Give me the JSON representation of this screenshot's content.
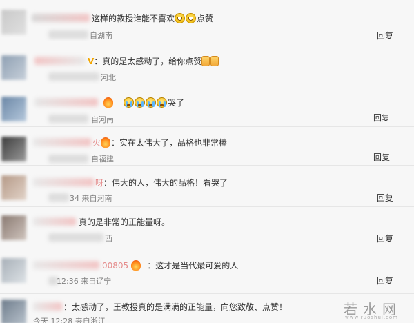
{
  "comments": [
    {
      "text": "这样的教授谁能不喜欢",
      "text_after": "点赞",
      "meta": "自湖南",
      "reply": "回复"
    },
    {
      "prefix": "V",
      "text": "：真的是太感动了，给你点赞",
      "meta": "河北"
    },
    {
      "text": "哭了",
      "meta": "自河南",
      "reply": "回复"
    },
    {
      "name_tail": "火",
      "text": "：实在太伟大了，品格也非常棒",
      "meta": "自福建",
      "reply": "回复"
    },
    {
      "name_tail": "呀",
      "text": "：伟大的人，伟大的品格！看哭了",
      "meta": "34 来自河南",
      "reply": "回复"
    },
    {
      "text": "真的是非常的正能量呀。",
      "meta": "西",
      "reply": "回复"
    },
    {
      "name_tail": "00805",
      "text": "：这才是当代最可爱的人",
      "meta": "12:36 来自辽宁",
      "reply": "回复"
    },
    {
      "text": "：太感动了，王教授真的是满满的正能量，向您致敬、点赞！",
      "meta": "今天 12:28 来自浙江"
    }
  ],
  "watermark": {
    "text": "若水网",
    "sub": "www.ruoshui.com"
  },
  "icons": {
    "laugh": "laughing-emoji-icon",
    "cry": "crying-emoji-icon",
    "thumb": "thumbs-up-icon",
    "fire": "fire-badge-icon"
  }
}
